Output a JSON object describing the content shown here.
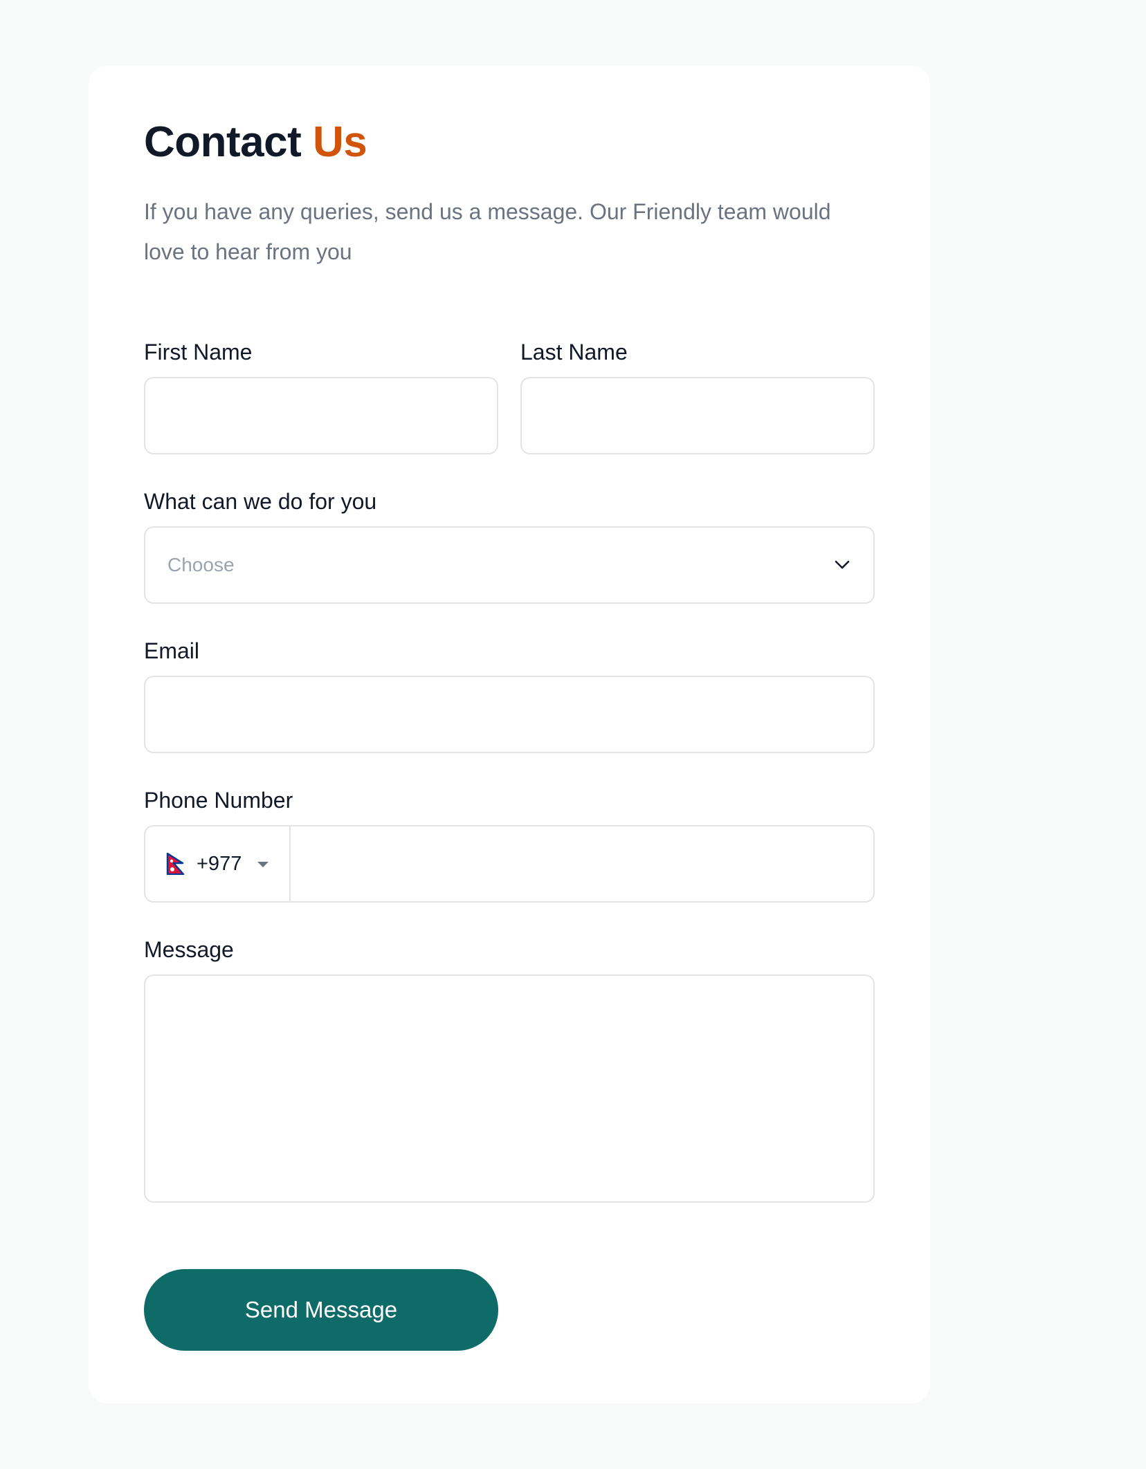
{
  "header": {
    "title_main": "Contact ",
    "title_accent": "Us",
    "subtitle": "If you have any queries, send us a message. Our Friendly team would love to hear from you"
  },
  "form": {
    "first_name_label": "First Name",
    "last_name_label": "Last Name",
    "service_label": "What can we do for you",
    "service_placeholder": "Choose",
    "email_label": "Email",
    "phone_label": "Phone Number",
    "country_code": "+977",
    "country_flag_icon": "nepal-flag-icon",
    "message_label": "Message",
    "submit_label": "Send Message"
  },
  "colors": {
    "accent": "#d0540a",
    "button": "#0f6b67",
    "heading": "#111827",
    "muted_text": "#6b7280",
    "border": "#e1e3e6",
    "page_background": "#f9fafa"
  }
}
